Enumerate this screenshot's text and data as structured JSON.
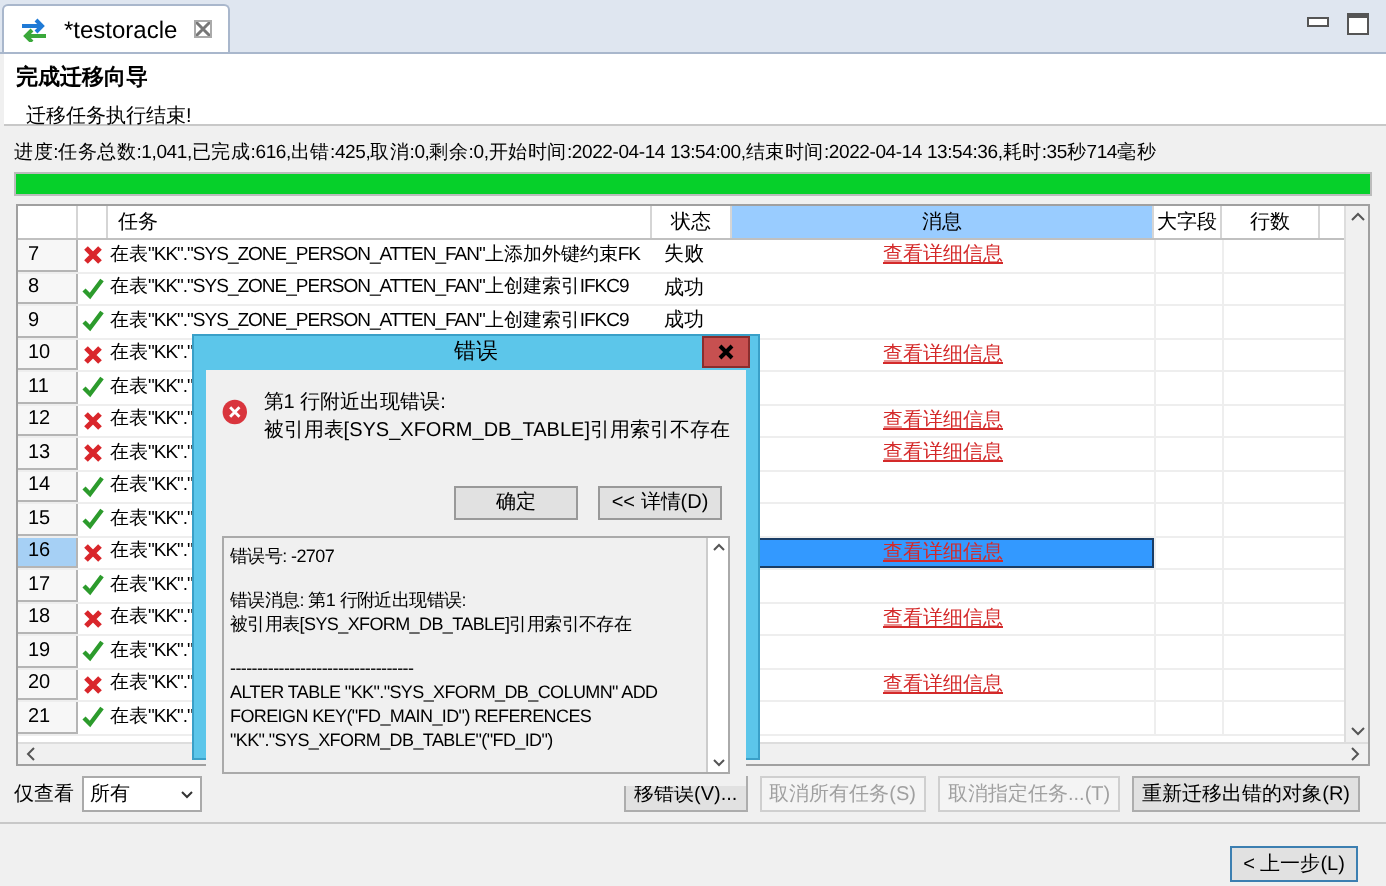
{
  "editor_tab": {
    "title": "*testoracle"
  },
  "wizard": {
    "title": "完成迁移向导",
    "message": "迁移任务执行结束!"
  },
  "progress": {
    "text": "进度:任务总数:1,041,已完成:616,出错:425,取消:0,剩余:0,开始时间:2022-04-14 13:54:00,结束时间:2022-04-14 13:54:36,耗时:35秒714毫秒",
    "level": 1
  },
  "table": {
    "columns": [
      {
        "label": "任务",
        "selected": false
      },
      {
        "label": "状态",
        "selected": false
      },
      {
        "label": "消息",
        "selected": true
      },
      {
        "label": "大字段",
        "selected": false
      },
      {
        "label": "行数",
        "selected": false
      }
    ],
    "rows": [
      {
        "number": "7",
        "kind": "failed",
        "task": "在表\"KK\".\"SYS_ZONE_PERSON_ATTEN_FAN\"上添加外键约束FK",
        "status": "失败",
        "message": "查看详细信息",
        "selected": false
      },
      {
        "number": "8",
        "kind": "succeeded",
        "task": "在表\"KK\".\"SYS_ZONE_PERSON_ATTEN_FAN\"上创建索引IFKC9",
        "status": "成功",
        "selected": false
      },
      {
        "number": "9",
        "kind": "succeeded",
        "task": "在表\"KK\".\"SYS_ZONE_PERSON_ATTEN_FAN\"上创建索引IFKC9",
        "status": "成功",
        "selected": false
      },
      {
        "number": "10",
        "kind": "failed",
        "task": "在表\"KK\".\"",
        "message": "查看详细信息",
        "selected": false
      },
      {
        "number": "11",
        "kind": "succeeded",
        "task": "在表\"KK\".\"",
        "selected": false
      },
      {
        "number": "12",
        "kind": "failed",
        "task": "在表\"KK\".\"",
        "message": "查看详细信息",
        "selected": false
      },
      {
        "number": "13",
        "kind": "failed",
        "task": "在表\"KK\".\"",
        "message": "查看详细信息",
        "selected": false
      },
      {
        "number": "14",
        "kind": "succeeded",
        "task": "在表\"KK\".\"",
        "selected": false
      },
      {
        "number": "15",
        "kind": "succeeded",
        "task": "在表\"KK\".\"",
        "selected": false
      },
      {
        "number": "16",
        "kind": "failed",
        "task": "在表\"KK\".\"",
        "message": "查看详细信息",
        "selected": true
      },
      {
        "number": "17",
        "kind": "succeeded",
        "task": "在表\"KK\".\"",
        "selected": false
      },
      {
        "number": "18",
        "kind": "failed",
        "task": "在表\"KK\".\"",
        "message": "查看详细信息",
        "selected": false
      },
      {
        "number": "19",
        "kind": "succeeded",
        "task": "在表\"KK\".\"",
        "selected": false
      },
      {
        "number": "20",
        "kind": "failed",
        "task": "在表\"KK\".\"",
        "message": "查看详细信息",
        "selected": false
      },
      {
        "number": "21",
        "kind": "succeeded",
        "task": "在表\"KK\".\"",
        "selected": false
      }
    ]
  },
  "filter": {
    "label": "仅查看",
    "value": "所有"
  },
  "buttons": [
    {
      "label": "移错误(V)...",
      "disabled": false
    },
    {
      "label": "取消所有任务(S)",
      "disabled": true
    },
    {
      "label": "取消指定任务...(T)",
      "disabled": true
    },
    {
      "label": "重新迁移出错的对象(R)",
      "disabled": false
    }
  ],
  "back_button": {
    "label": "< 上一步(L)"
  },
  "dialog": {
    "title": "错误",
    "message_lines": [
      "第1 行附近出现错误:",
      "被引用表[SYS_XFORM_DB_TABLE]引用索引不存在"
    ],
    "buttons": [
      {
        "label": "确定"
      },
      {
        "label": "<< 详情(D)"
      }
    ],
    "detail_paragraphs": [
      {
        "lines": [
          "错误号:   -2707"
        ]
      },
      {
        "lines": [
          "错误消息: 第1 行附近出现错误:",
          "被引用表[SYS_XFORM_DB_TABLE]引用索引不存在"
        ]
      },
      {
        "lines": [
          "----------------------------------",
          "ALTER TABLE \"KK\".\"SYS_XFORM_DB_COLUMN\" ADD",
          "FOREIGN KEY(\"FD_MAIN_ID\") REFERENCES",
          "\"KK\".\"SYS_XFORM_DB_TABLE\"(\"FD_ID\")"
        ]
      }
    ]
  }
}
